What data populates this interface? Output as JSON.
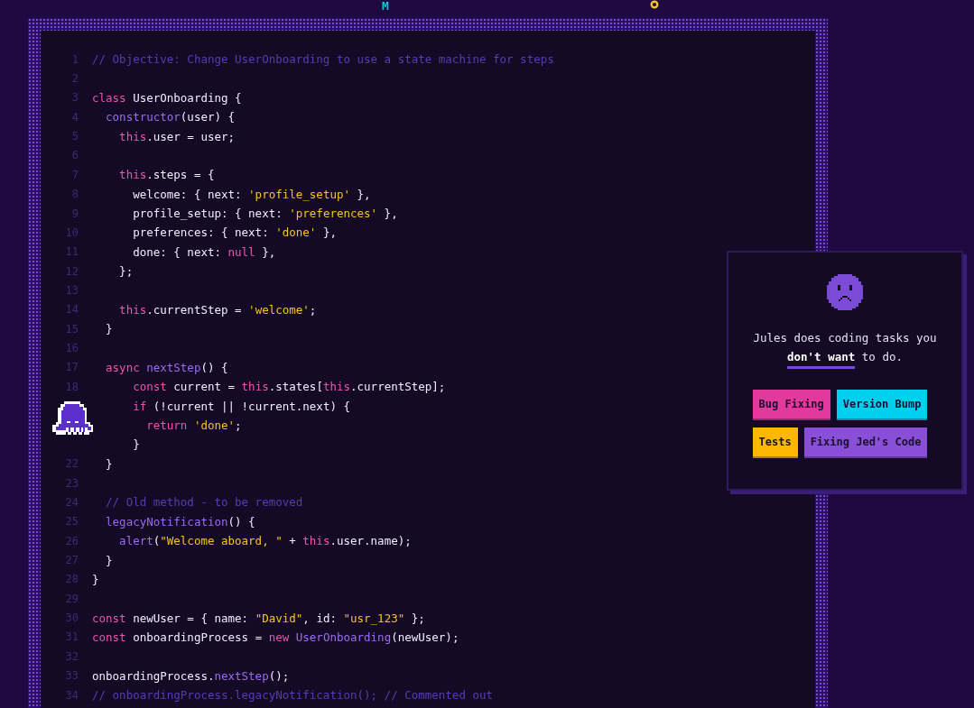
{
  "top_strip": {
    "letter": "M"
  },
  "editor": {
    "lines": [
      {
        "number": "1",
        "tokens": [
          {
            "kind": "comment",
            "text": "// Objective: Change UserOnboarding to use a state machine for steps"
          }
        ]
      },
      {
        "number": "2"
      },
      {
        "number": "3",
        "tokens": [
          {
            "kind": "keyword",
            "text": "class"
          },
          {
            "kind": "plain",
            "text": " UserOnboarding {"
          }
        ]
      },
      {
        "number": "4",
        "tokens": [
          {
            "kind": "function",
            "text": "  constructor"
          },
          {
            "kind": "plain",
            "text": "(user) {"
          }
        ]
      },
      {
        "number": "5",
        "tokens": [
          {
            "kind": "keyword",
            "text": "    this"
          },
          {
            "kind": "plain",
            "text": ".user = user;"
          }
        ]
      },
      {
        "number": "6"
      },
      {
        "number": "7",
        "tokens": [
          {
            "kind": "keyword",
            "text": "    this"
          },
          {
            "kind": "plain",
            "text": ".steps = {"
          }
        ]
      },
      {
        "number": "8",
        "tokens": [
          {
            "kind": "plain",
            "text": "      welcome: { next: "
          },
          {
            "kind": "string",
            "text": "'profile_setup'"
          },
          {
            "kind": "plain",
            "text": " },"
          }
        ]
      },
      {
        "number": "9",
        "tokens": [
          {
            "kind": "plain",
            "text": "      profile_setup: { next: "
          },
          {
            "kind": "string",
            "text": "'preferences'"
          },
          {
            "kind": "plain",
            "text": " },"
          }
        ]
      },
      {
        "number": "10",
        "tokens": [
          {
            "kind": "plain",
            "text": "      preferences: { next: "
          },
          {
            "kind": "string",
            "text": "'done'"
          },
          {
            "kind": "plain",
            "text": " },"
          }
        ]
      },
      {
        "number": "11",
        "tokens": [
          {
            "kind": "plain",
            "text": "      done: { next: "
          },
          {
            "kind": "keyword",
            "text": "null"
          },
          {
            "kind": "plain",
            "text": " },"
          }
        ]
      },
      {
        "number": "12",
        "tokens": [
          {
            "kind": "plain",
            "text": "    };"
          }
        ]
      },
      {
        "number": "13"
      },
      {
        "number": "14",
        "tokens": [
          {
            "kind": "keyword",
            "text": "    this"
          },
          {
            "kind": "plain",
            "text": ".currentStep = "
          },
          {
            "kind": "string",
            "text": "'welcome'"
          },
          {
            "kind": "plain",
            "text": ";"
          }
        ]
      },
      {
        "number": "15",
        "tokens": [
          {
            "kind": "plain",
            "text": "  }"
          }
        ]
      },
      {
        "number": "16"
      },
      {
        "number": "17",
        "tokens": [
          {
            "kind": "keyword",
            "text": "  async "
          },
          {
            "kind": "function",
            "text": "nextStep"
          },
          {
            "kind": "plain",
            "text": "() {"
          }
        ]
      },
      {
        "number": "18",
        "tokens": [
          {
            "kind": "keyword",
            "text": "      const"
          },
          {
            "kind": "plain",
            "text": " current = "
          },
          {
            "kind": "keyword",
            "text": "this"
          },
          {
            "kind": "plain",
            "text": ".states["
          },
          {
            "kind": "keyword",
            "text": "this"
          },
          {
            "kind": "plain",
            "text": ".currentStep];"
          }
        ]
      },
      {
        "tokens": [
          {
            "kind": "keyword",
            "text": "      if"
          },
          {
            "kind": "plain",
            "text": " (!current || !current.next) {"
          }
        ]
      },
      {
        "tokens": [
          {
            "kind": "keyword",
            "text": "        return "
          },
          {
            "kind": "string",
            "text": "'done'"
          },
          {
            "kind": "plain",
            "text": ";"
          }
        ]
      },
      {
        "tokens": [
          {
            "kind": "plain",
            "text": "      }"
          }
        ]
      },
      {
        "number": "22",
        "tokens": [
          {
            "kind": "plain",
            "text": "  }"
          }
        ]
      },
      {
        "number": "23"
      },
      {
        "number": "24",
        "tokens": [
          {
            "kind": "comment",
            "text": "  // Old method - to be removed"
          }
        ]
      },
      {
        "number": "25",
        "tokens": [
          {
            "kind": "function",
            "text": "  legacyNotification"
          },
          {
            "kind": "plain",
            "text": "() {"
          }
        ]
      },
      {
        "number": "26",
        "tokens": [
          {
            "kind": "function",
            "text": "    alert"
          },
          {
            "kind": "plain",
            "text": "("
          },
          {
            "kind": "string",
            "text": "\"Welcome aboard, \""
          },
          {
            "kind": "plain",
            "text": " + "
          },
          {
            "kind": "keyword",
            "text": "this"
          },
          {
            "kind": "plain",
            "text": ".user.name);"
          }
        ]
      },
      {
        "number": "27",
        "tokens": [
          {
            "kind": "plain",
            "text": "  }"
          }
        ]
      },
      {
        "number": "28",
        "tokens": [
          {
            "kind": "plain",
            "text": "}"
          }
        ]
      },
      {
        "number": "29"
      },
      {
        "number": "30",
        "tokens": [
          {
            "kind": "keyword",
            "text": "const"
          },
          {
            "kind": "plain",
            "text": " newUser = { name: "
          },
          {
            "kind": "string",
            "text": "\"David\""
          },
          {
            "kind": "plain",
            "text": ", id: "
          },
          {
            "kind": "string",
            "text": "\"usr_123\""
          },
          {
            "kind": "plain",
            "text": " };"
          }
        ]
      },
      {
        "number": "31",
        "tokens": [
          {
            "kind": "keyword",
            "text": "const"
          },
          {
            "kind": "plain",
            "text": " onboardingProcess = "
          },
          {
            "kind": "keyword",
            "text": "new "
          },
          {
            "kind": "function",
            "text": "UserOnboarding"
          },
          {
            "kind": "plain",
            "text": "(newUser);"
          }
        ]
      },
      {
        "number": "32"
      },
      {
        "number": "33",
        "tokens": [
          {
            "kind": "plain",
            "text": "onboardingProcess."
          },
          {
            "kind": "function",
            "text": "nextStep"
          },
          {
            "kind": "plain",
            "text": "();"
          }
        ]
      },
      {
        "number": "34",
        "tokens": [
          {
            "kind": "comment",
            "text": "// onboardingProcess.legacyNotification(); // Commented out"
          }
        ]
      }
    ]
  },
  "card": {
    "tagline": "Jules does coding tasks you **don't want** to do.",
    "tags": [
      {
        "label": "Bug Fixing",
        "color": "#e23a9c"
      },
      {
        "label": "Version Bump",
        "color": "#00d0ee"
      },
      {
        "label": "Tests",
        "color": "#ffb800"
      },
      {
        "label": "Fixing Jed's Code",
        "color": "#8a4fd8"
      }
    ]
  }
}
